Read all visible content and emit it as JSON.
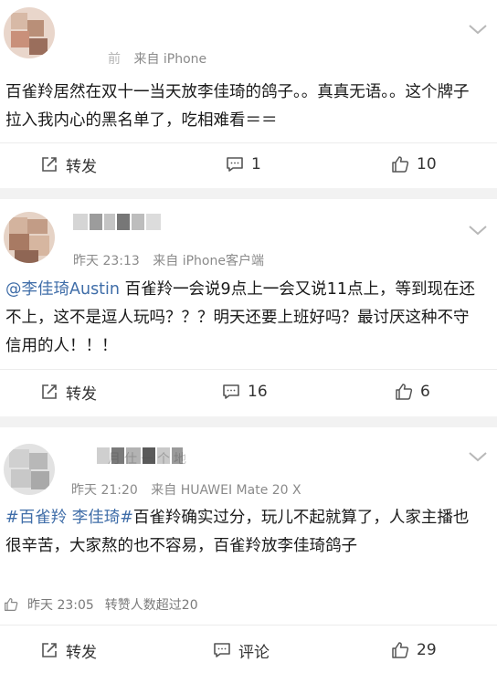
{
  "posts": [
    {
      "meta": {
        "time_fragment": "前",
        "source": "来自 iPhone"
      },
      "body": "百雀羚居然在双十一当天放李佳琦的鸽子。。真真无语。。这个牌子拉入我内心的黑名单了，吃相难看＝＝",
      "actions": {
        "repost": "转发",
        "comment": "1",
        "like": "10"
      },
      "icons": {
        "repost": "repost-icon",
        "comment": "comment-icon",
        "like": "like-icon",
        "menu": "chevron-down-icon"
      }
    },
    {
      "meta": {
        "time": "昨天 23:13",
        "source": "来自 iPhone客户端"
      },
      "mention": "@李佳琦Austin",
      "body": " 百雀羚一会说9点上一会又说11点上，等到现在还不上，这不是逗人玩吗？？？明天还要上班好吗？最讨厌这种不守信用的人！！！",
      "actions": {
        "repost": "转发",
        "comment": "16",
        "like": "6"
      },
      "icons": {
        "repost": "repost-icon",
        "comment": "comment-icon",
        "like": "like-icon",
        "menu": "chevron-down-icon"
      }
    },
    {
      "name_fragment": "月仕一个地",
      "meta": {
        "time": "昨天 21:20",
        "source": "来自 HUAWEI Mate 20 X"
      },
      "hashtag": "#百雀羚 李佳琦#",
      "body": "百雀羚确实过分，玩儿不起就算了，人家主播也很辛苦，大家熬的也不容易，百雀羚放李佳琦鸽子",
      "like_line": {
        "time": "昨天 23:05",
        "text": "转赞人数超过20"
      },
      "actions": {
        "repost": "转发",
        "comment": "评论",
        "like": "29"
      },
      "icons": {
        "repost": "repost-icon",
        "comment": "comment-icon",
        "like": "like-icon",
        "menu": "chevron-down-icon"
      }
    }
  ],
  "colors": {
    "link": "#3f6da8",
    "meta": "#8a8a8a",
    "background": "#f2f2f2"
  }
}
